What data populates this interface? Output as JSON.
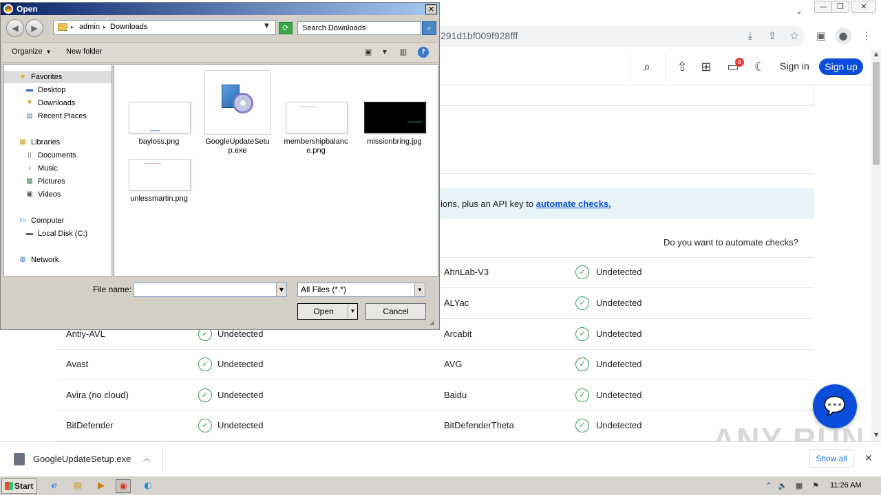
{
  "browser": {
    "url": "291d1bf009f928fff",
    "window_controls": {
      "minimize": "—",
      "restore": "❐",
      "close": "✕"
    },
    "toolbar_icons": [
      "download-icon",
      "share-icon",
      "star-icon",
      "sidebar-icon",
      "profile-icon",
      "menu-icon"
    ],
    "tab_search_glyph": "⌄"
  },
  "site": {
    "header": {
      "notification_count": "8",
      "signin": "Sign in",
      "signup": "Sign up"
    },
    "banner": {
      "text": "ions, plus an API key to ",
      "link": "automate checks."
    },
    "automate_question": "Do you want to automate checks?",
    "detections": [
      {
        "left": "",
        "left_status": "",
        "right": "AhnLab-V3",
        "right_status": "Undetected"
      },
      {
        "left": "",
        "left_status": "",
        "right": "ALYac",
        "right_status": "Undetected"
      },
      {
        "left": "Antiy-AVL",
        "left_status": "Undetected",
        "right": "Arcabit",
        "right_status": "Undetected"
      },
      {
        "left": "Avast",
        "left_status": "Undetected",
        "right": "AVG",
        "right_status": "Undetected"
      },
      {
        "left": "Avira (no cloud)",
        "left_status": "Undetected",
        "right": "Baidu",
        "right_status": "Undetected"
      },
      {
        "left": "BitDefender",
        "left_status": "Undetected",
        "right": "BitDefenderTheta",
        "right_status": "Undetected"
      }
    ],
    "watermark": "ANY RUN"
  },
  "download_bar": {
    "file_name": "GoogleUpdateSetup.exe",
    "show_all": "Show all"
  },
  "taskbar": {
    "start": "Start",
    "clock": "11:26 AM"
  },
  "dialog": {
    "title": "Open",
    "address": {
      "segment1": "admin",
      "segment2": "Downloads"
    },
    "search_placeholder": "Search Downloads",
    "organize": "Organize",
    "new_folder": "New folder",
    "nav": {
      "favorites": "Favorites",
      "desktop": "Desktop",
      "downloads": "Downloads",
      "recent_places": "Recent Places",
      "libraries": "Libraries",
      "documents": "Documents",
      "music": "Music",
      "pictures": "Pictures",
      "videos": "Videos",
      "computer": "Computer",
      "local_disk": "Local Disk (C:)",
      "network": "Network"
    },
    "files": [
      {
        "name": "bayloss.png"
      },
      {
        "name": "GoogleUpdateSetup.exe"
      },
      {
        "name": "membershipbalance.png"
      },
      {
        "name": "missionbring.jpg"
      },
      {
        "name": "unlessmartin.png"
      }
    ],
    "file_name_label": "File name:",
    "file_name_value": "",
    "file_type": "All Files (*.*)",
    "open": "Open",
    "cancel": "Cancel"
  },
  "colors": {
    "accent_blue": "#0b4dda",
    "success_green": "#2e9e52",
    "banner_bg": "#e6f4fa"
  }
}
